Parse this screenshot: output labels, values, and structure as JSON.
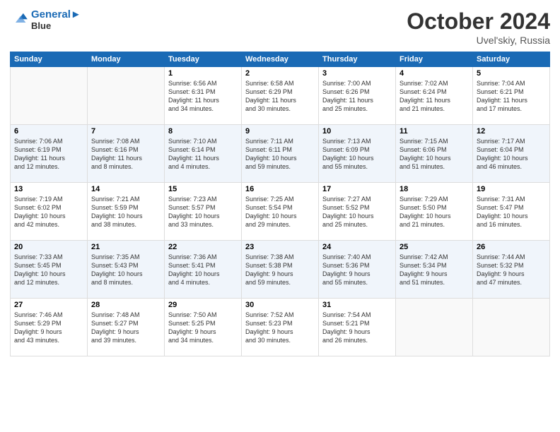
{
  "logo": {
    "line1": "General",
    "line2": "Blue"
  },
  "title": "October 2024",
  "location": "Uvel'skiy, Russia",
  "days_of_week": [
    "Sunday",
    "Monday",
    "Tuesday",
    "Wednesday",
    "Thursday",
    "Friday",
    "Saturday"
  ],
  "weeks": [
    [
      {
        "day": "",
        "info": ""
      },
      {
        "day": "",
        "info": ""
      },
      {
        "day": "1",
        "info": "Sunrise: 6:56 AM\nSunset: 6:31 PM\nDaylight: 11 hours\nand 34 minutes."
      },
      {
        "day": "2",
        "info": "Sunrise: 6:58 AM\nSunset: 6:29 PM\nDaylight: 11 hours\nand 30 minutes."
      },
      {
        "day": "3",
        "info": "Sunrise: 7:00 AM\nSunset: 6:26 PM\nDaylight: 11 hours\nand 25 minutes."
      },
      {
        "day": "4",
        "info": "Sunrise: 7:02 AM\nSunset: 6:24 PM\nDaylight: 11 hours\nand 21 minutes."
      },
      {
        "day": "5",
        "info": "Sunrise: 7:04 AM\nSunset: 6:21 PM\nDaylight: 11 hours\nand 17 minutes."
      }
    ],
    [
      {
        "day": "6",
        "info": "Sunrise: 7:06 AM\nSunset: 6:19 PM\nDaylight: 11 hours\nand 12 minutes."
      },
      {
        "day": "7",
        "info": "Sunrise: 7:08 AM\nSunset: 6:16 PM\nDaylight: 11 hours\nand 8 minutes."
      },
      {
        "day": "8",
        "info": "Sunrise: 7:10 AM\nSunset: 6:14 PM\nDaylight: 11 hours\nand 4 minutes."
      },
      {
        "day": "9",
        "info": "Sunrise: 7:11 AM\nSunset: 6:11 PM\nDaylight: 10 hours\nand 59 minutes."
      },
      {
        "day": "10",
        "info": "Sunrise: 7:13 AM\nSunset: 6:09 PM\nDaylight: 10 hours\nand 55 minutes."
      },
      {
        "day": "11",
        "info": "Sunrise: 7:15 AM\nSunset: 6:06 PM\nDaylight: 10 hours\nand 51 minutes."
      },
      {
        "day": "12",
        "info": "Sunrise: 7:17 AM\nSunset: 6:04 PM\nDaylight: 10 hours\nand 46 minutes."
      }
    ],
    [
      {
        "day": "13",
        "info": "Sunrise: 7:19 AM\nSunset: 6:02 PM\nDaylight: 10 hours\nand 42 minutes."
      },
      {
        "day": "14",
        "info": "Sunrise: 7:21 AM\nSunset: 5:59 PM\nDaylight: 10 hours\nand 38 minutes."
      },
      {
        "day": "15",
        "info": "Sunrise: 7:23 AM\nSunset: 5:57 PM\nDaylight: 10 hours\nand 33 minutes."
      },
      {
        "day": "16",
        "info": "Sunrise: 7:25 AM\nSunset: 5:54 PM\nDaylight: 10 hours\nand 29 minutes."
      },
      {
        "day": "17",
        "info": "Sunrise: 7:27 AM\nSunset: 5:52 PM\nDaylight: 10 hours\nand 25 minutes."
      },
      {
        "day": "18",
        "info": "Sunrise: 7:29 AM\nSunset: 5:50 PM\nDaylight: 10 hours\nand 21 minutes."
      },
      {
        "day": "19",
        "info": "Sunrise: 7:31 AM\nSunset: 5:47 PM\nDaylight: 10 hours\nand 16 minutes."
      }
    ],
    [
      {
        "day": "20",
        "info": "Sunrise: 7:33 AM\nSunset: 5:45 PM\nDaylight: 10 hours\nand 12 minutes."
      },
      {
        "day": "21",
        "info": "Sunrise: 7:35 AM\nSunset: 5:43 PM\nDaylight: 10 hours\nand 8 minutes."
      },
      {
        "day": "22",
        "info": "Sunrise: 7:36 AM\nSunset: 5:41 PM\nDaylight: 10 hours\nand 4 minutes."
      },
      {
        "day": "23",
        "info": "Sunrise: 7:38 AM\nSunset: 5:38 PM\nDaylight: 9 hours\nand 59 minutes."
      },
      {
        "day": "24",
        "info": "Sunrise: 7:40 AM\nSunset: 5:36 PM\nDaylight: 9 hours\nand 55 minutes."
      },
      {
        "day": "25",
        "info": "Sunrise: 7:42 AM\nSunset: 5:34 PM\nDaylight: 9 hours\nand 51 minutes."
      },
      {
        "day": "26",
        "info": "Sunrise: 7:44 AM\nSunset: 5:32 PM\nDaylight: 9 hours\nand 47 minutes."
      }
    ],
    [
      {
        "day": "27",
        "info": "Sunrise: 7:46 AM\nSunset: 5:29 PM\nDaylight: 9 hours\nand 43 minutes."
      },
      {
        "day": "28",
        "info": "Sunrise: 7:48 AM\nSunset: 5:27 PM\nDaylight: 9 hours\nand 39 minutes."
      },
      {
        "day": "29",
        "info": "Sunrise: 7:50 AM\nSunset: 5:25 PM\nDaylight: 9 hours\nand 34 minutes."
      },
      {
        "day": "30",
        "info": "Sunrise: 7:52 AM\nSunset: 5:23 PM\nDaylight: 9 hours\nand 30 minutes."
      },
      {
        "day": "31",
        "info": "Sunrise: 7:54 AM\nSunset: 5:21 PM\nDaylight: 9 hours\nand 26 minutes."
      },
      {
        "day": "",
        "info": ""
      },
      {
        "day": "",
        "info": ""
      }
    ]
  ]
}
